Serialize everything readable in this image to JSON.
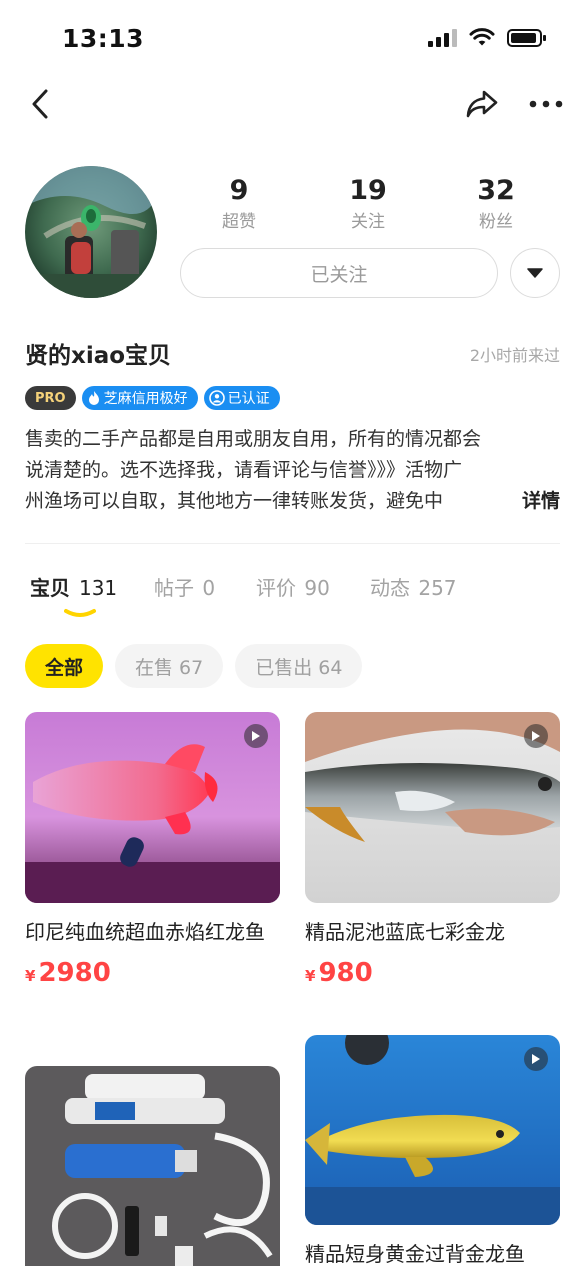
{
  "status_bar": {
    "time": "13:13"
  },
  "profile": {
    "stats": [
      {
        "value": "9",
        "label": "超赞"
      },
      {
        "value": "19",
        "label": "关注"
      },
      {
        "value": "32",
        "label": "粉丝"
      }
    ],
    "follow_label": "已关注",
    "username": "贤的xiao宝贝",
    "last_seen": "2小时前来过",
    "badges": {
      "pro": "PRO",
      "credit": "芝麻信用极好",
      "verified": "已认证"
    },
    "bio_lines": [
      "售卖的二手产品都是自用或朋友自用，所有的情况都会",
      "说清楚的。选不选择我，请看评论与信誉》》》活物广",
      "州渔场可以自取，其他地方一律转账发货，避免中"
    ],
    "bio_more": "详情"
  },
  "tabs": [
    {
      "label": "宝贝",
      "count": "131"
    },
    {
      "label": "帖子",
      "count": "0"
    },
    {
      "label": "评价",
      "count": "90"
    },
    {
      "label": "动态",
      "count": "257"
    }
  ],
  "filters": [
    {
      "label": "全部"
    },
    {
      "label": "在售 67"
    },
    {
      "label": "已售出 64"
    }
  ],
  "items": [
    {
      "title": "印尼纯血统超血赤焰红龙鱼",
      "price_symbol": "¥",
      "price": "2980"
    },
    {
      "title": "精品泥池蓝底七彩金龙",
      "price_symbol": "¥",
      "price": "980"
    },
    {
      "title": ""
    },
    {
      "title": "精品短身黄金过背金龙鱼"
    }
  ],
  "colors": {
    "accent": "#ffe300",
    "price": "#ff4444",
    "badge_blue": "#1a8ef2",
    "badge_pro_bg": "#3a3a3a"
  }
}
